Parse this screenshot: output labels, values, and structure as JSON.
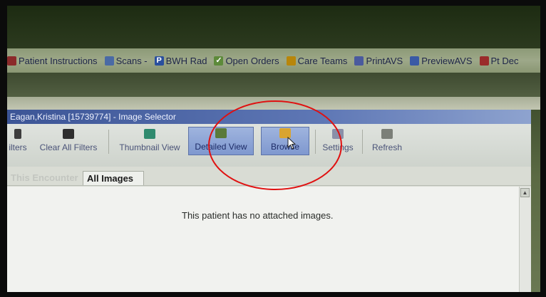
{
  "app_toolbar": {
    "items": [
      {
        "label": "Patient Instructions",
        "icon": "document-icon",
        "color": "#8b2a2a"
      },
      {
        "label": "Scans -",
        "icon": "scan-icon",
        "color": "#4a6aa5"
      },
      {
        "label": "BWH Rad",
        "icon": "p-icon",
        "color": "#2a4f9e"
      },
      {
        "label": "Open Orders",
        "icon": "check-icon",
        "color": "#5d8a3a"
      },
      {
        "label": "Care Teams",
        "icon": "people-icon",
        "color": "#b8860b"
      },
      {
        "label": "PrintAVS",
        "icon": "printer-icon",
        "color": "#4a5a9e"
      },
      {
        "label": "PreviewAVS",
        "icon": "preview-icon",
        "color": "#3a5aa5"
      },
      {
        "label": "Pt Dec",
        "icon": "patient-icon",
        "color": "#9a2b2b"
      }
    ]
  },
  "window": {
    "title": "Eagan,Kristina [15739774] - Image Selector"
  },
  "toolbar": {
    "buttons": [
      {
        "label": "ilters",
        "icon": "filter-icon"
      },
      {
        "label": "Clear All Filters",
        "icon": "clear-filters-icon"
      },
      {
        "label": "Thumbnail View",
        "icon": "thumbnail-icon"
      },
      {
        "label": "Detailed View",
        "icon": "detailed-view-icon"
      },
      {
        "label": "Browse",
        "icon": "folder-icon"
      },
      {
        "label": "Settings",
        "icon": "settings-icon"
      },
      {
        "label": "Refresh",
        "icon": "refresh-icon"
      }
    ]
  },
  "tabs": [
    {
      "label": "This Encounter"
    },
    {
      "label": "All Images"
    }
  ],
  "content": {
    "message": "This patient has no attached images."
  },
  "accent_colors": {
    "annotation_circle": "#e01010",
    "title_bar": "#3c5596",
    "active_button": "#8ea6d8"
  }
}
